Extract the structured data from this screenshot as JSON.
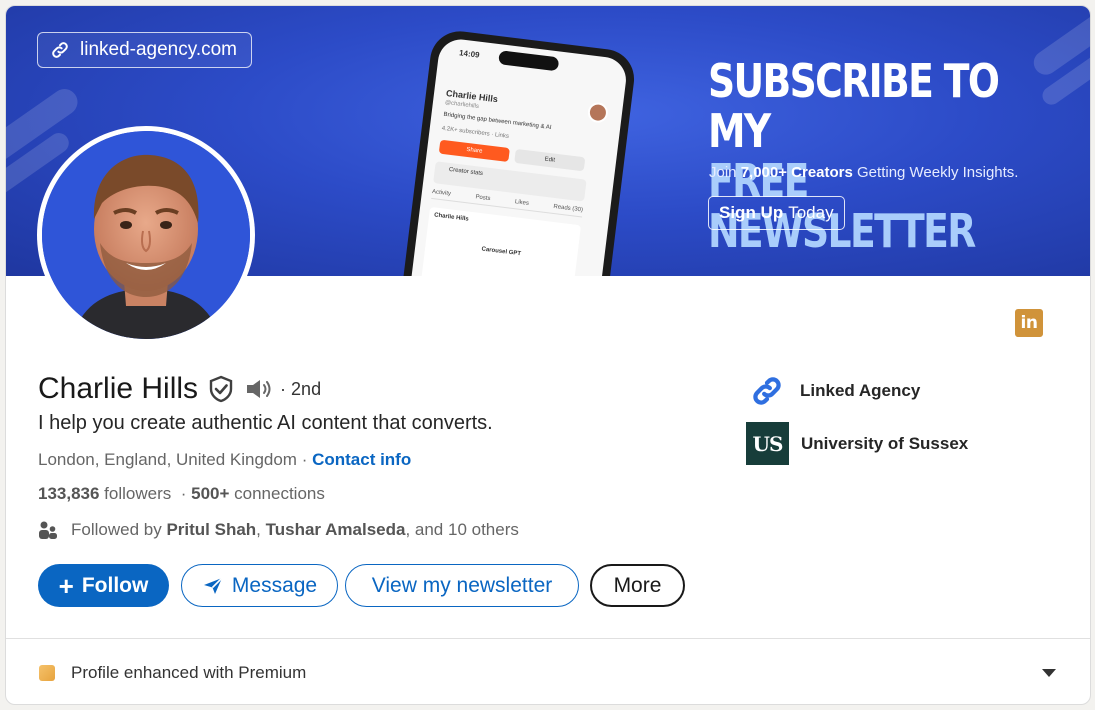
{
  "banner": {
    "url": "linked-agency.com",
    "headline_line1": "SUBSCRIBE TO MY",
    "headline_line2": "FREE NEWSLETTER",
    "sub_prefix": "Join ",
    "sub_bold": "7,000+ Creators",
    "sub_suffix": " Getting Weekly Insights.",
    "cta_bold": "Sign Up",
    "cta_rest": "Today",
    "phone": {
      "time": "14:09",
      "name": "Charlie Hills",
      "handle": "@charliehills",
      "bio": "Bridging the gap between marketing & AI",
      "subscribers": "4.2K+ subscribers · Links",
      "share": "Share",
      "edit": "Edit",
      "stats": "Creator stats",
      "tabs": [
        "Activity",
        "Posts",
        "Likes",
        "Reads (30)"
      ],
      "post_author": "Charlie Hills",
      "post_title": "Carousel GPT"
    }
  },
  "profile": {
    "name": "Charlie Hills",
    "degree": "· 2nd",
    "headline": "I help you create authentic AI content that converts.",
    "location": "London, England, United Kingdom · ",
    "contact_info": "Contact info",
    "followers_count": "133,836",
    "followers_label": " followers",
    "connections_sep": "  · ",
    "connections_count": "500+",
    "connections_label": " connections",
    "mutual_prefix": "Followed by ",
    "mutual_1": "Pritul Shah",
    "mutual_sep": ", ",
    "mutual_2": "Tushar Amalseda",
    "mutual_suffix": ", and 10 others"
  },
  "actions": {
    "follow": "Follow",
    "message": "Message",
    "newsletter": "View my newsletter",
    "more": "More"
  },
  "organizations": [
    {
      "name": "Linked Agency",
      "logo": "link-icon"
    },
    {
      "name": "University of Sussex",
      "logo_text": "US"
    }
  ],
  "premium": {
    "label": "Profile enhanced with Premium"
  },
  "badge": {
    "text": "in"
  },
  "colors": {
    "linkedin_blue": "#0a66c2",
    "banner_blue": "#2c4bc7",
    "premium_gold": "#e7a33e"
  }
}
